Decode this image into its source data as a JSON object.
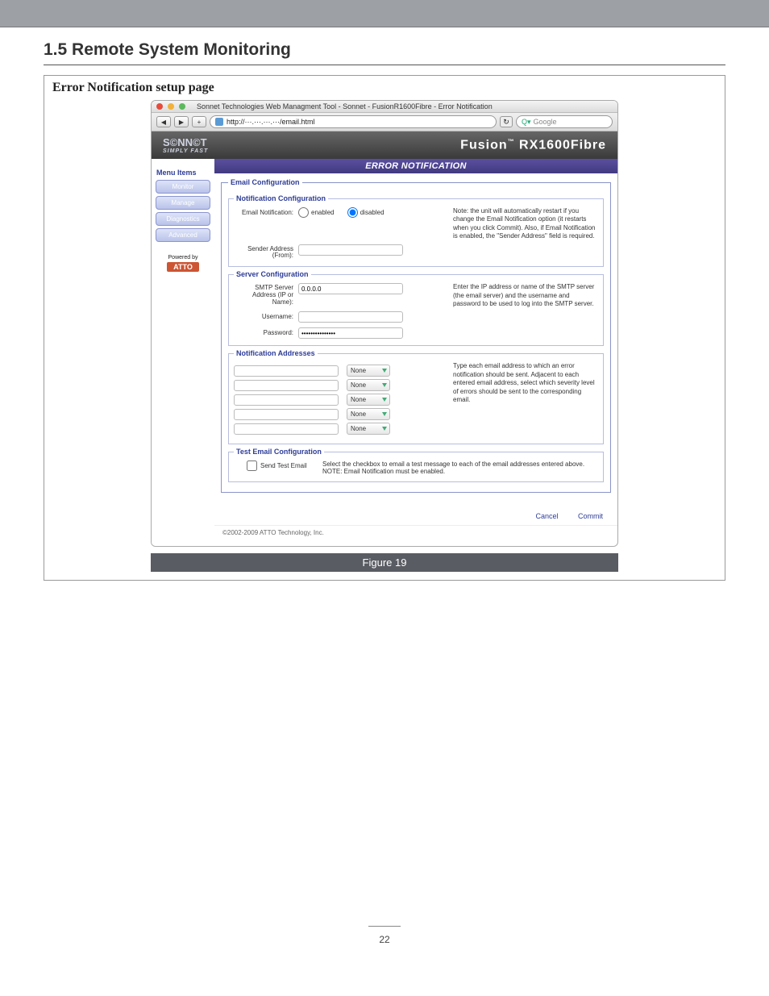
{
  "section_heading": "1.5 Remote System Monitoring",
  "figure_caption": "Error Notification setup page",
  "figure_label": "Figure 19",
  "page_number": "22",
  "browser": {
    "tab_title": "Sonnet Technologies Web Managment Tool - Sonnet - FusionR1600Fibre - Error Notification",
    "url": "http://···.···.···.···/email.html",
    "reload_symbol": "↻",
    "search_placeholder": "Google",
    "brand_logo": "S©NN©T",
    "brand_tag": "SIMPLY FAST",
    "brand_product": "Fusion™ RX1600Fibre"
  },
  "sidebar": {
    "header": "Menu Items",
    "items": [
      "Monitor",
      "Manage",
      "Diagnostics",
      "Advanced"
    ],
    "powered_by_label": "Powered by",
    "powered_by_brand": "ATTO"
  },
  "content": {
    "page_title": "Error Notification",
    "email_config_legend": "Email Configuration",
    "notif_config": {
      "legend": "Notification Configuration",
      "label_notify": "Email Notification:",
      "opt_enabled": "enabled",
      "opt_disabled": "disabled",
      "label_sender": "Sender Address (From):",
      "hint": "Note: the unit will automatically restart if you change the Email Notification option (it restarts when you click Commit). Also, if Email Notification is enabled, the \"Sender Address\" field is required."
    },
    "server_config": {
      "legend": "Server Configuration",
      "label_addr": "SMTP Server Address (IP or Name):",
      "addr_value": "0.0.0.0",
      "label_user": "Username:",
      "label_pass": "Password:",
      "pass_value": "•••••••••••••••",
      "hint": "Enter the IP address or name of the SMTP server (the email server) and the username and password to be used to log into the SMTP server."
    },
    "notif_addr": {
      "legend": "Notification Addresses",
      "select_value": "None",
      "hint": "Type each email address to which an error notification should be sent. Adjacent to each entered email address, select which severity level of errors should be sent to the corresponding email."
    },
    "test_email": {
      "legend": "Test Email Configuration",
      "checkbox_label": "Send Test Email",
      "hint": "Select the checkbox to email a test message to each of the email addresses entered above. NOTE: Email Notification must be enabled."
    },
    "buttons": {
      "cancel": "Cancel",
      "commit": "Commit"
    },
    "copyright": "©2002-2009 ATTO Technology, Inc."
  }
}
